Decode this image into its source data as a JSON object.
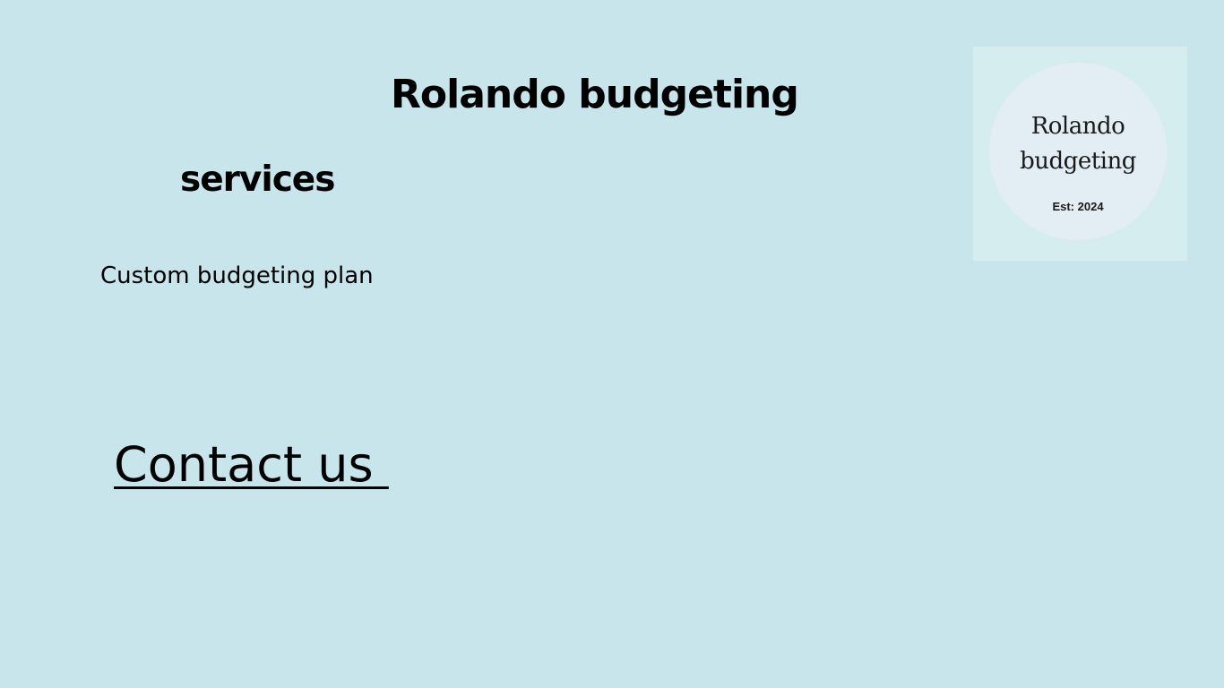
{
  "header": {
    "title": "Rolando budgeting"
  },
  "services": {
    "heading": "services",
    "items": [
      "Custom budgeting plan"
    ]
  },
  "contact": {
    "label": "Contact us "
  },
  "logo": {
    "line1": "Rolando",
    "line2": "budgeting",
    "established": "Est: 2024"
  },
  "colors": {
    "background": "#c7e5eb",
    "logo_card": "#d6edef",
    "logo_circle": "#e2eef3",
    "text": "#000000"
  }
}
